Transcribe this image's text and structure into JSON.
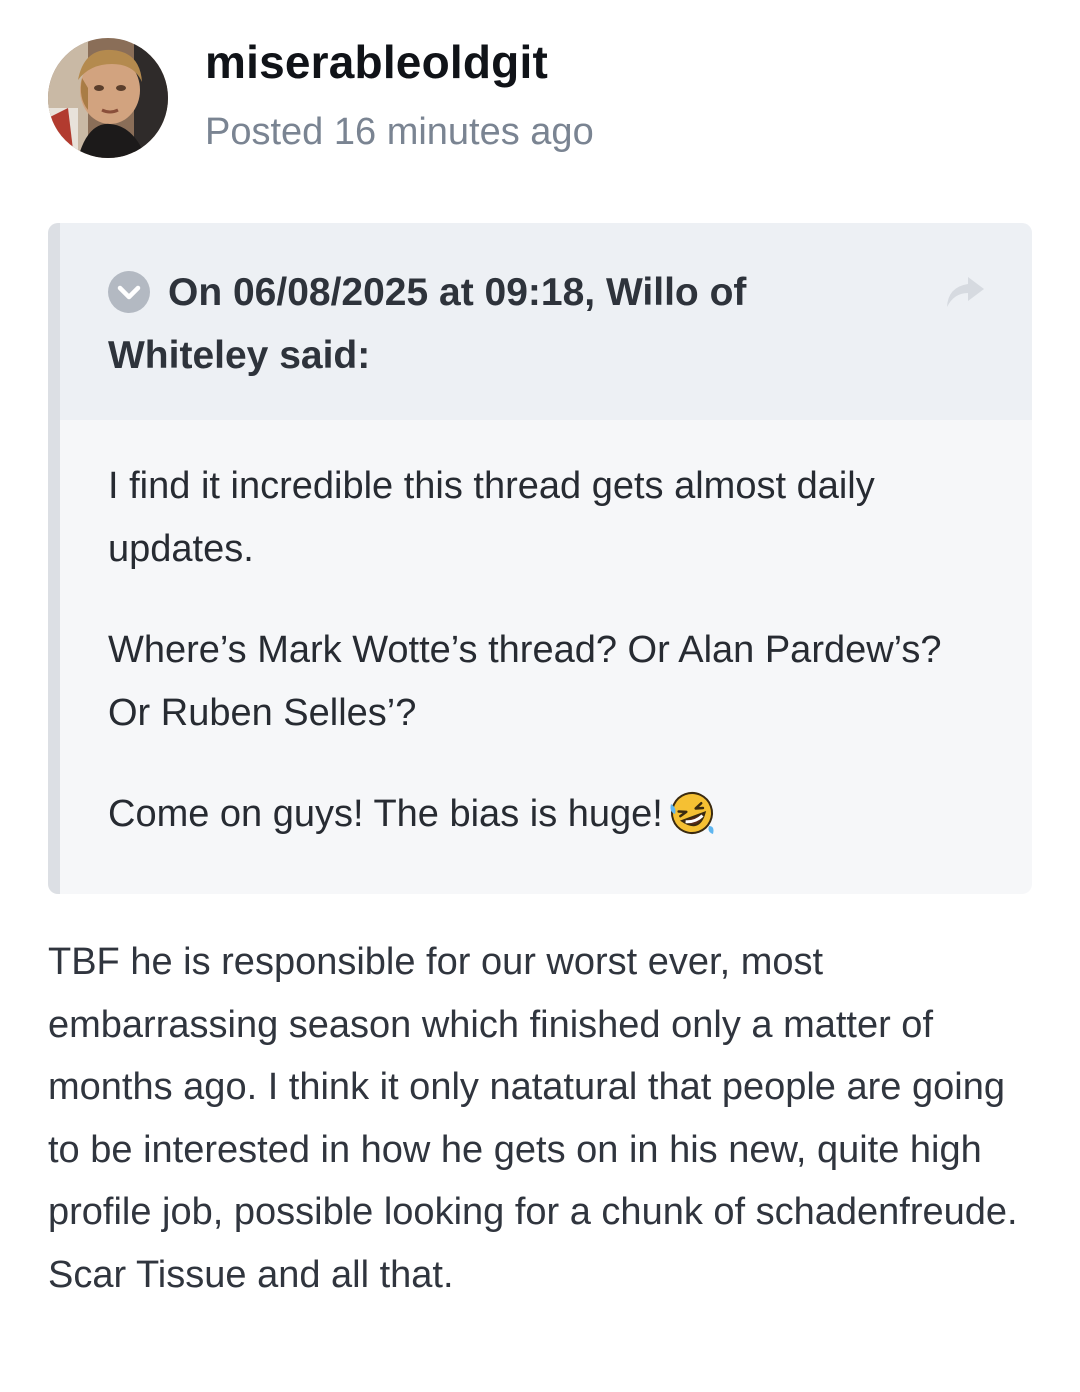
{
  "post": {
    "author": "miserableoldgit",
    "posted": "Posted 16 minutes ago",
    "avatar_icon": "user-avatar-photo"
  },
  "quote": {
    "citation": "On 06/08/2025 at 09:18, Willo of Whiteley said:",
    "collapse_icon": "chevron-down-circle-icon",
    "share_icon": "share-arrow-icon",
    "paragraphs": [
      "I find it incredible this thread gets almost daily updates.",
      "Where’s Mark Wotte’s thread? Or Alan Pardew’s? Or Ruben Selles’?",
      "Come on guys! The bias is huge!"
    ],
    "emoji": "rolling-on-floor-laughing-emoji"
  },
  "reply": {
    "text": "TBF he is responsible for our worst ever, most embarrassing season which finished only a matter of months ago. I think it only natatural that people are going to be interested in how he gets on in his new, quite high profile job, possible looking for a chunk of schadenfreude. Scar Tissue and all that."
  },
  "colors": {
    "citation_background": "#edf0f4",
    "quote_background": "#f6f7f9",
    "quote_bar": "#dcdfe4",
    "meta_text": "#7a8492"
  }
}
